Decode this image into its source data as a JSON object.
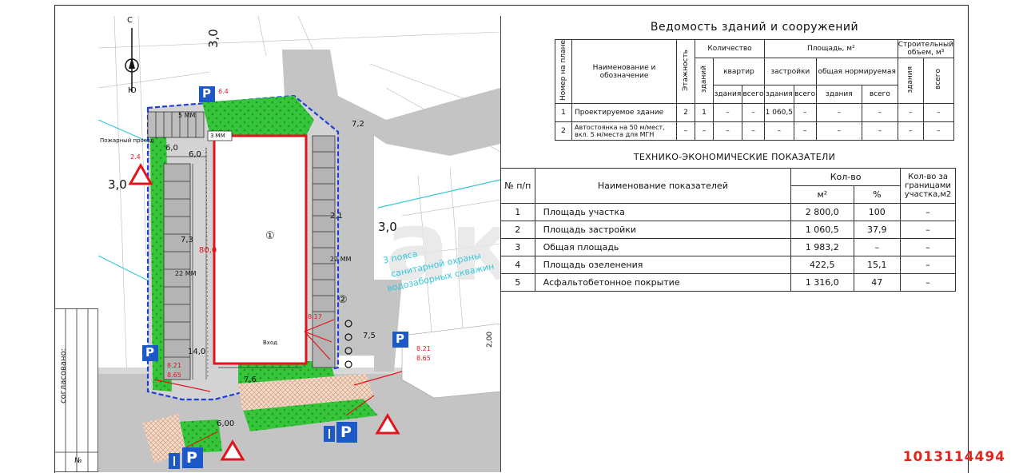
{
  "plan": {
    "north": "С",
    "south": "Ю",
    "dim_top": "3,0",
    "dim_left": "3,0",
    "dim_right": "3,0",
    "dim_72": "7,2",
    "dim_60a": "6,0",
    "dim_60b": "6,0",
    "dim_73": "7,3",
    "dim_80": "80,0",
    "dim_21": "2,1",
    "dim_75": "7,5",
    "dim_140": "14,0",
    "dim_76": "7,6",
    "dim_600": "6,00",
    "dim_200": "2,00",
    "dim_64": "6.4",
    "dim_24": "2.4",
    "dim_817": "8.17",
    "dim_821a": "8.21",
    "dim_865a": "8.65",
    "dim_821b": "8.21",
    "dim_865b": "8.65",
    "mm5": "5 ММ",
    "mm22a": "22 ММ",
    "mm22b": "22 ММ",
    "mm3": "3 ММ",
    "fire_lane": "Пожарный проезд",
    "entrance": "Вход",
    "bldg1": "①",
    "bldg2": "②",
    "zone_line1": "3 пояса",
    "zone_line2": "санитарной охраны",
    "zone_line3": "водозаборных скважин",
    "parking_letter": "P"
  },
  "stamp": {
    "label": "согласовано:",
    "no": "№"
  },
  "table1": {
    "title": "Ведомость зданий и сооружений",
    "h_num": "Номер на плане",
    "h_name": "Наименование и обозначение",
    "h_floors": "Этажность",
    "h_qty": "Количество",
    "h_bldg": "зданий",
    "h_apts": "квартир",
    "h_apt_bldg": "здания",
    "h_apt_total": "всего",
    "h_area": "Площадь, м²",
    "h_built": "застройки",
    "h_norm": "общая нормируемая",
    "h_b_bldg": "здания",
    "h_b_total": "всего",
    "h_n_bldg": "здания",
    "h_n_total": "всего",
    "h_volume": "Строительный объем, м³",
    "h_v_bldg": "здания",
    "h_v_total": "всего",
    "rows": [
      [
        "1",
        "Проектируемое здание",
        "2",
        "1",
        "–",
        "–",
        "1 060,5",
        "–",
        "–",
        "–",
        "–",
        "–"
      ],
      [
        "2",
        "Автостоянка на 50 м/мест, вкл. 5 м/места для МГН",
        "–",
        "–",
        "–",
        "–",
        "–",
        "–",
        "–",
        "–",
        "–",
        "–"
      ]
    ]
  },
  "table2": {
    "title": "ТЕХНИКО-ЭКОНОМИЧЕСКИЕ ПОКАЗАТЕЛИ",
    "h_num": "№ п/п",
    "h_name": "Наименование показателей",
    "h_qty": "Кол-во",
    "h_m2": "м²",
    "h_pct": "%",
    "h_outside": "Кол-во за границами участка,м2",
    "rows": [
      [
        "1",
        "Площадь участка",
        "2 800,0",
        "100",
        "–"
      ],
      [
        "2",
        "Площадь застройки",
        "1 060,5",
        "37,9",
        "–"
      ],
      [
        "3",
        "Общая площадь",
        "1 983,2",
        "–",
        "–"
      ],
      [
        "4",
        "Площадь озеленения",
        "422,5",
        "15,1",
        "–"
      ],
      [
        "5",
        "Асфальтобетонное покрытие",
        "1 316,0",
        "47",
        "–"
      ]
    ]
  },
  "listing_id": "1013114494"
}
